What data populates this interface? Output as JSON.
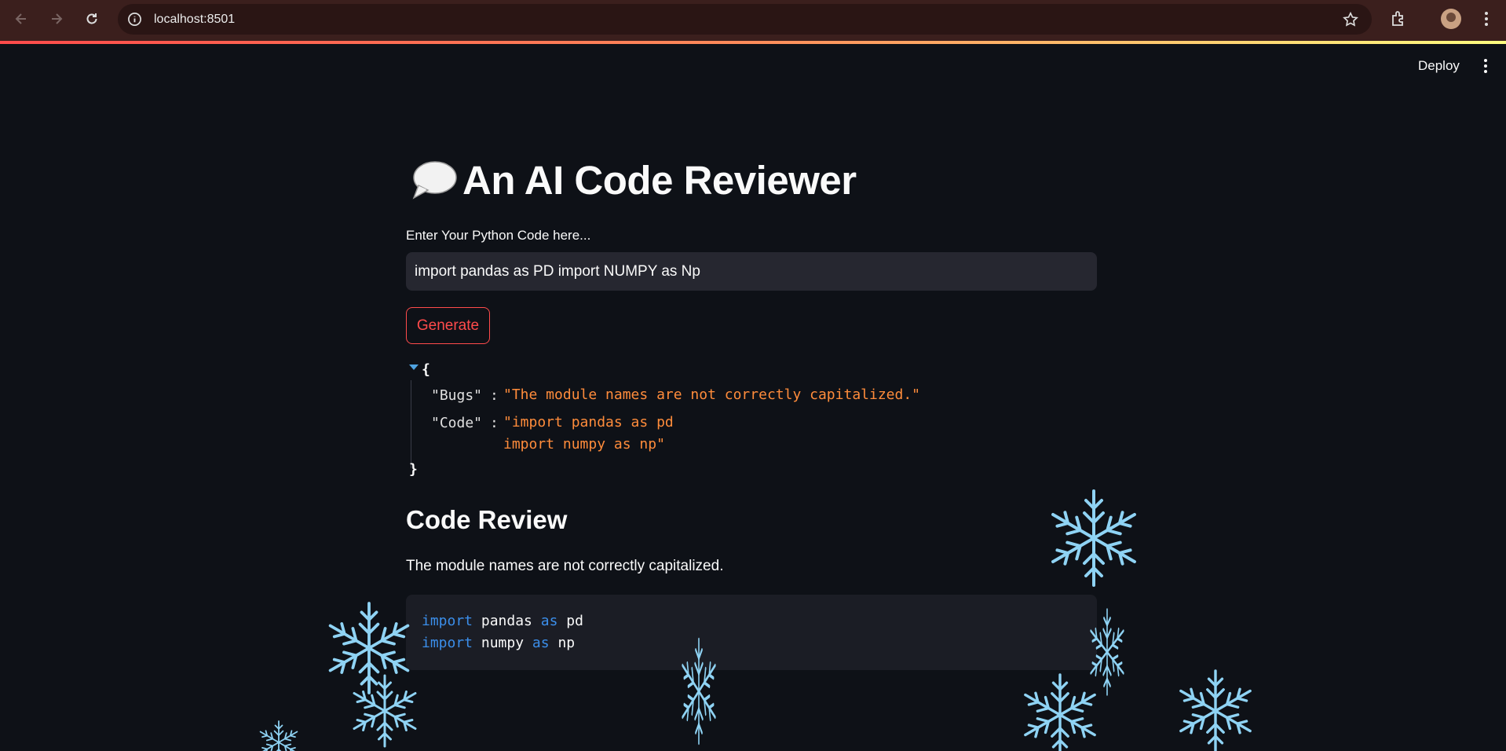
{
  "browser": {
    "url": "localhost:8501"
  },
  "header": {
    "deploy_label": "Deploy"
  },
  "app": {
    "title": "An AI Code Reviewer",
    "title_icon": "speech-balloon-icon",
    "input_label": "Enter Your Python Code here...",
    "input_value": "import pandas as PD import NUMPY as Np",
    "generate_label": "Generate"
  },
  "json_output": {
    "open_brace": "{",
    "close_brace": "}",
    "bugs_key": "\"Bugs\"",
    "bugs_value": "\"The module names are not correctly capitalized.\"",
    "code_key": "\"Code\"",
    "code_value_line1": "\"import pandas as pd",
    "code_value_line2": "import numpy as np\"",
    "colon": ":"
  },
  "review": {
    "heading": "Code Review",
    "summary": "The module names are not correctly capitalized.",
    "code_lines": [
      {
        "kw1": "import",
        "mod": "pandas",
        "kw2": "as",
        "alias": "pd"
      },
      {
        "kw1": "import",
        "mod": "numpy",
        "kw2": "as",
        "alias": "np"
      }
    ]
  },
  "colors": {
    "background": "#0e1117",
    "accent": "#ff4b4b",
    "json_string": "#ff8c3b",
    "keyword": "#3b8eea",
    "snowflake": "#8fd3f4"
  }
}
